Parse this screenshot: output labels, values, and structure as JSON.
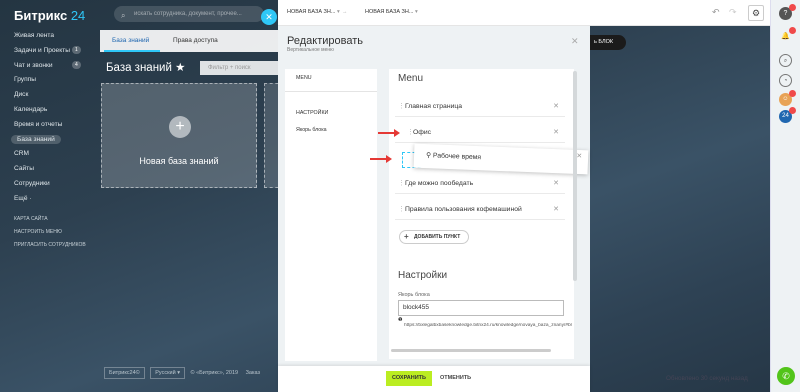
{
  "app": {
    "logo_main": "Битрикс",
    "logo_num": "24",
    "search_placeholder": "искать сотрудника, документ, прочее..."
  },
  "sidebar": {
    "items": [
      {
        "label": "Живая лента"
      },
      {
        "label": "Задачи и Проекты",
        "count": "1"
      },
      {
        "label": "Чат и звонки",
        "count": "4"
      },
      {
        "label": "Группы"
      },
      {
        "label": "Диск"
      },
      {
        "label": "Календарь"
      },
      {
        "label": "Время и отчеты"
      },
      {
        "label": "База знаний",
        "active": true
      },
      {
        "label": "CRM"
      },
      {
        "label": "Сайты"
      },
      {
        "label": "Сотрудники"
      },
      {
        "label": "Ещё ·"
      }
    ],
    "links": [
      "КАРТА САЙТА",
      "НАСТРОИТЬ МЕНЮ",
      "ПРИГЛАСИТЬ СОТРУДНИКОВ"
    ]
  },
  "background": {
    "tabs": [
      "База знаний",
      "Права доступа"
    ],
    "title": "База знаний",
    "star": "★",
    "filter_placeholder": "Фильтр + поиск",
    "card_label": "Новая база знаний",
    "block_button": "ь БЛОК",
    "footer": {
      "brand": "Битрикс24©",
      "lang": "Русский",
      "copyright": "© «Битрикс», 2019",
      "extra": "Заказ"
    },
    "updated": "Обновлено 30 секунд назад"
  },
  "topbar": {
    "crumb1": "НОВАЯ БАЗА ЗН...",
    "crumb2": "НОВАЯ БАЗА ЗН..."
  },
  "modal": {
    "title": "Редактировать",
    "subtitle": "Вертикальное меню",
    "left": {
      "menu": "MENU",
      "settings": "НАСТРОЙКИ",
      "anchor": "Якорь блока"
    },
    "menu_title": "Menu",
    "items": [
      "Главная страница",
      "Офис",
      "Где можно пообедать",
      "Правила пользования кофемашиной"
    ],
    "dragging_item": "Рабочее время",
    "add_item": "ДОБАВИТЬ ПУНКТ",
    "settings_title": "Настройки",
    "anchor_label": "Якорь блока",
    "anchor_value": "block455",
    "info_icon": "❶",
    "anchor_url": "https://bxlegalbxbaseknowledge.bitrix24.ru/knowledge/novaya_baza_znany/#block455",
    "save": "СОХРАНИТЬ",
    "cancel": "ОТМЕНИТЬ"
  },
  "rightbar": {
    "avatar_badge": "24"
  },
  "colors": {
    "accent": "#2fc7f7",
    "save": "#bbed21",
    "arrow": "#e53935",
    "badge": "#f04a4a"
  }
}
